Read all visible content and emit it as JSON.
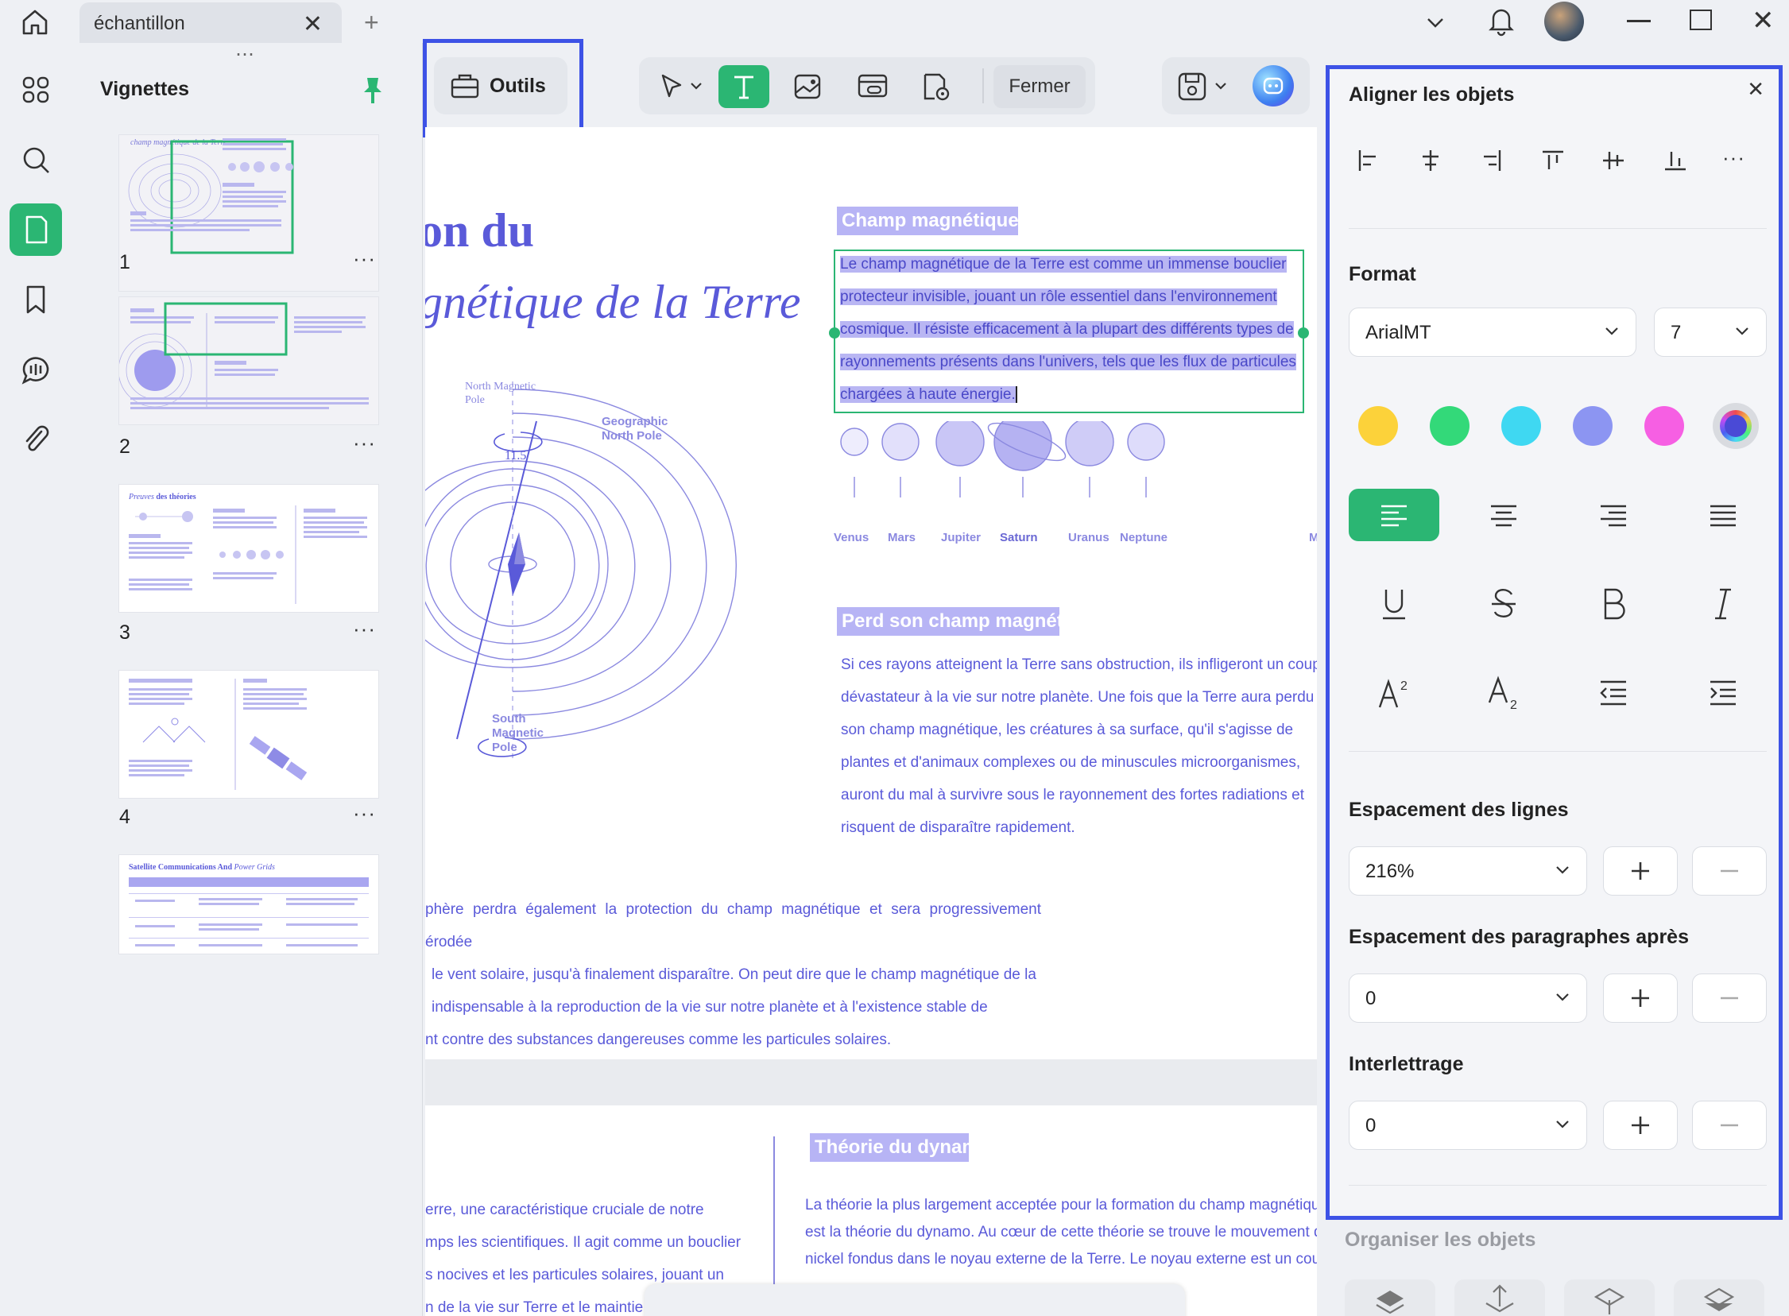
{
  "tab": {
    "title": "échantillon"
  },
  "sidebar": {
    "title": "Vignettes",
    "pages": [
      "1",
      "2",
      "3",
      "4"
    ]
  },
  "thumb3": {
    "title_italic": "Preuves",
    "title_bold": "des théories"
  },
  "thumb5": {
    "title_bold": "Satellite Communications And",
    "title_italic": "Power Grids"
  },
  "toolbar": {
    "tools_label": "Outils",
    "close_label": "Fermer"
  },
  "document": {
    "heading_line1": "on du",
    "heading_line2": "gnétique de la Terre",
    "section1_title": "Champ magnétique",
    "section1_lines": [
      "Le champ magnétique de la Terre est comme un immense bouclier",
      "protecteur invisible, jouant un rôle essentiel dans l'environnement",
      "cosmique. Il résiste efficacement à la plupart des différents types de",
      "rayonnements présents dans l'univers, tels que les flux de particules",
      "chargées à haute énergie."
    ],
    "planets": [
      "Venus",
      "Mars",
      "Jupiter",
      "Saturn",
      "Uranus",
      "Neptune",
      "M"
    ],
    "diagram_labels": {
      "north_magnetic": "North Magnetic Pole",
      "geographic_north": "Geographic North Pole",
      "south_magnetic": "South Magnetic Pole",
      "angle": "11.5"
    },
    "section2_title": "Perd son champ magnétiqu",
    "section2_lines": [
      "Si ces rayons atteignent la Terre sans obstruction, ils infligeront un coup",
      "dévastateur à la vie sur notre planète. Une fois que la Terre aura perdu",
      "son champ magnétique, les créatures à sa surface, qu'il s'agisse de",
      "plantes et d'animaux complexes ou de minuscules microorganismes,",
      "auront du mal à survivre sous le rayonnement des fortes radiations et",
      "risquent de disparaître rapidement."
    ],
    "body_lines": [
      "phère perdra également la protection du champ magnétique et sera progressivement érodée",
      "le vent solaire, jusqu'à finalement disparaître. On peut dire que le champ magnétique de la",
      "indispensable à la reproduction de la vie sur notre planète et à l'existence stable de",
      "nt contre des substances dangereuses comme les particules solaires."
    ],
    "section3_title": "Théorie du dynam",
    "left_col_lines": [
      "erre, une caractéristique cruciale de notre",
      "mps les scientifiques. Il agit comme un bouclier",
      "s nocives et les particules solaires, jouant un",
      "n de la vie sur Terre et le maintie"
    ],
    "right_col_lines": [
      "La théorie la plus largement acceptée pour la formation du champ magnétique",
      "est la théorie du dynamo. Au cœur de cette théorie se trouve le mouvement du",
      "nickel fondus dans le noyau externe de la Terre. Le noyau externe est un cou"
    ]
  },
  "panel": {
    "align_title": "Aligner les objets",
    "format_title": "Format",
    "font_name": "ArialMT",
    "font_size": "7",
    "colors": [
      "#fcd23a",
      "#33d979",
      "#3fd8f2",
      "#8c95f2",
      "#f65fe3"
    ],
    "line_spacing_title": "Espacement des lignes",
    "line_spacing_value": "216%",
    "para_spacing_title": "Espacement des paragraphes après",
    "para_spacing_value": "0",
    "letter_spacing_title": "Interlettrage",
    "letter_spacing_value": "0",
    "organize_title": "Organiser les objets"
  },
  "colors": {
    "accent": "#2bb673",
    "highlight": "#3d52e6",
    "doc_text": "#5a5ad9"
  }
}
